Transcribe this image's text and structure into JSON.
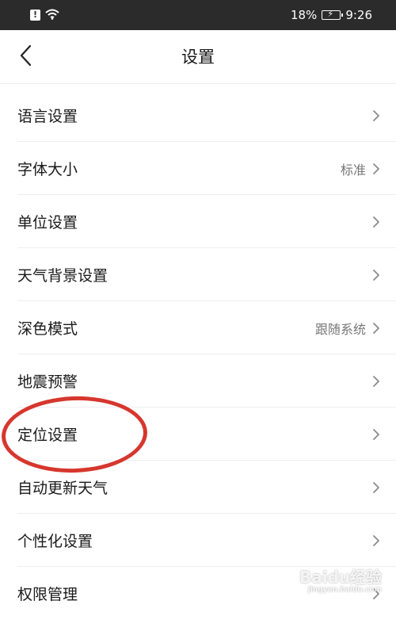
{
  "status_bar": {
    "sim_icon": "sim-alert-icon",
    "wifi_icon": "wifi-icon",
    "battery_percent": "18%",
    "battery_icon": "battery-charging-icon",
    "time": "9:26"
  },
  "header": {
    "back_icon": "chevron-left-icon",
    "title": "设置"
  },
  "settings": {
    "items": [
      {
        "label": "语言设置",
        "value": ""
      },
      {
        "label": "字体大小",
        "value": "标准"
      },
      {
        "label": "单位设置",
        "value": ""
      },
      {
        "label": "天气背景设置",
        "value": ""
      },
      {
        "label": "深色模式",
        "value": "跟随系统"
      },
      {
        "label": "地震预警",
        "value": ""
      },
      {
        "label": "定位设置",
        "value": ""
      },
      {
        "label": "自动更新天气",
        "value": ""
      },
      {
        "label": "个性化设置",
        "value": ""
      },
      {
        "label": "权限管理",
        "value": ""
      }
    ],
    "chevron_icon": "chevron-right-icon"
  },
  "annotation": {
    "highlight_color": "#d6372e"
  },
  "watermark": {
    "text": "Baidu经验",
    "sub": "jingyan.baidu.com"
  }
}
